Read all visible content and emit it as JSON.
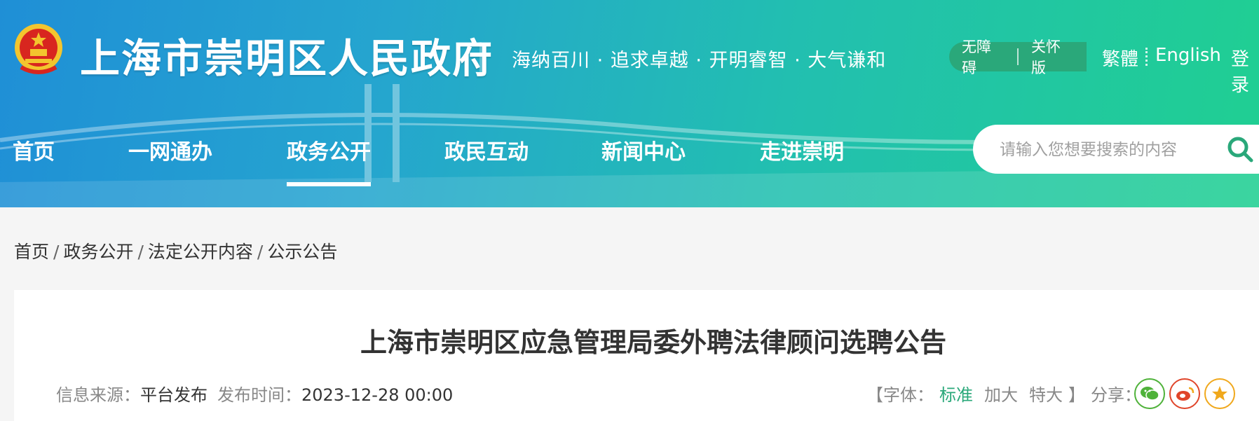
{
  "header": {
    "site_title": "上海市崇明区人民政府",
    "slogan": "海纳百川 · 追求卓越 · 开明睿智 · 大气谦和",
    "accessibility": {
      "barrier_free": "无障碍",
      "care_mode": "关怀版"
    },
    "lang_traditional": "繁體",
    "lang_english": "English",
    "login": "登录"
  },
  "nav": {
    "items": [
      {
        "label": "首页"
      },
      {
        "label": "一网通办"
      },
      {
        "label": "政务公开"
      },
      {
        "label": "政民互动"
      },
      {
        "label": "新闻中心"
      },
      {
        "label": "走进崇明"
      }
    ],
    "active_index": 2
  },
  "search": {
    "placeholder": "请输入您想要搜索的内容"
  },
  "breadcrumb": {
    "items": [
      "首页",
      "政务公开",
      "法定公开内容",
      "公示公告"
    ],
    "separator": "/"
  },
  "article": {
    "title": "上海市崇明区应急管理局委外聘法律顾问选聘公告",
    "source_label": "信息来源：",
    "source_value": "平台发布",
    "time_label": "发布时间：",
    "time_value": "2023-12-28 00:00",
    "font_size": {
      "open_bracket": "【字体：",
      "options": [
        "标准",
        "加大",
        "特大"
      ],
      "close_bracket": "】",
      "active_index": 0
    },
    "share_label": "分享：",
    "share_icons": [
      "wechat-icon",
      "weibo-icon",
      "favorite-star-icon"
    ]
  },
  "colors": {
    "accent": "#2aa87a",
    "header_start": "#1f8fd6",
    "header_end": "#20cf92",
    "wechat": "#4fb23a",
    "weibo": "#e0452a",
    "star": "#f0a81c"
  }
}
